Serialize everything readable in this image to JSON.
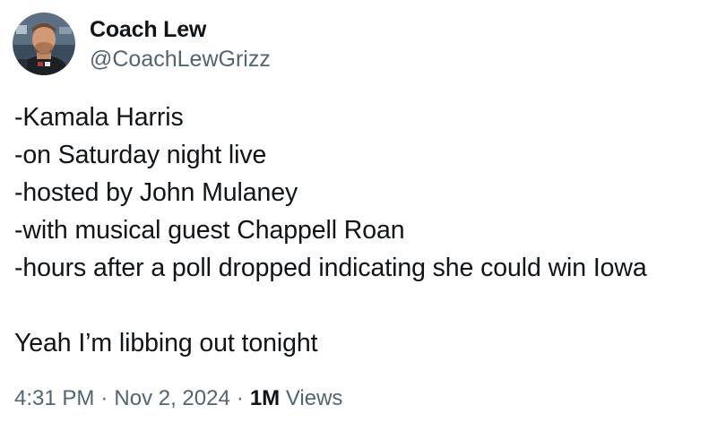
{
  "author": {
    "display_name": "Coach Lew",
    "handle": "@CoachLewGrizz"
  },
  "tweet": {
    "lines": [
      "-Kamala Harris",
      "-on Saturday night live",
      "-hosted by John Mulaney",
      "-with musical guest Chappell Roan",
      "-hours after a poll dropped indicating she could win Iowa"
    ],
    "closing": "Yeah I’m libbing out tonight"
  },
  "meta": {
    "time": "4:31 PM",
    "separator": "·",
    "date": "Nov 2, 2024",
    "views_count": "1M",
    "views_label": "Views"
  },
  "colors": {
    "text_primary": "#0f1419",
    "text_secondary": "#536471",
    "background": "#ffffff"
  }
}
